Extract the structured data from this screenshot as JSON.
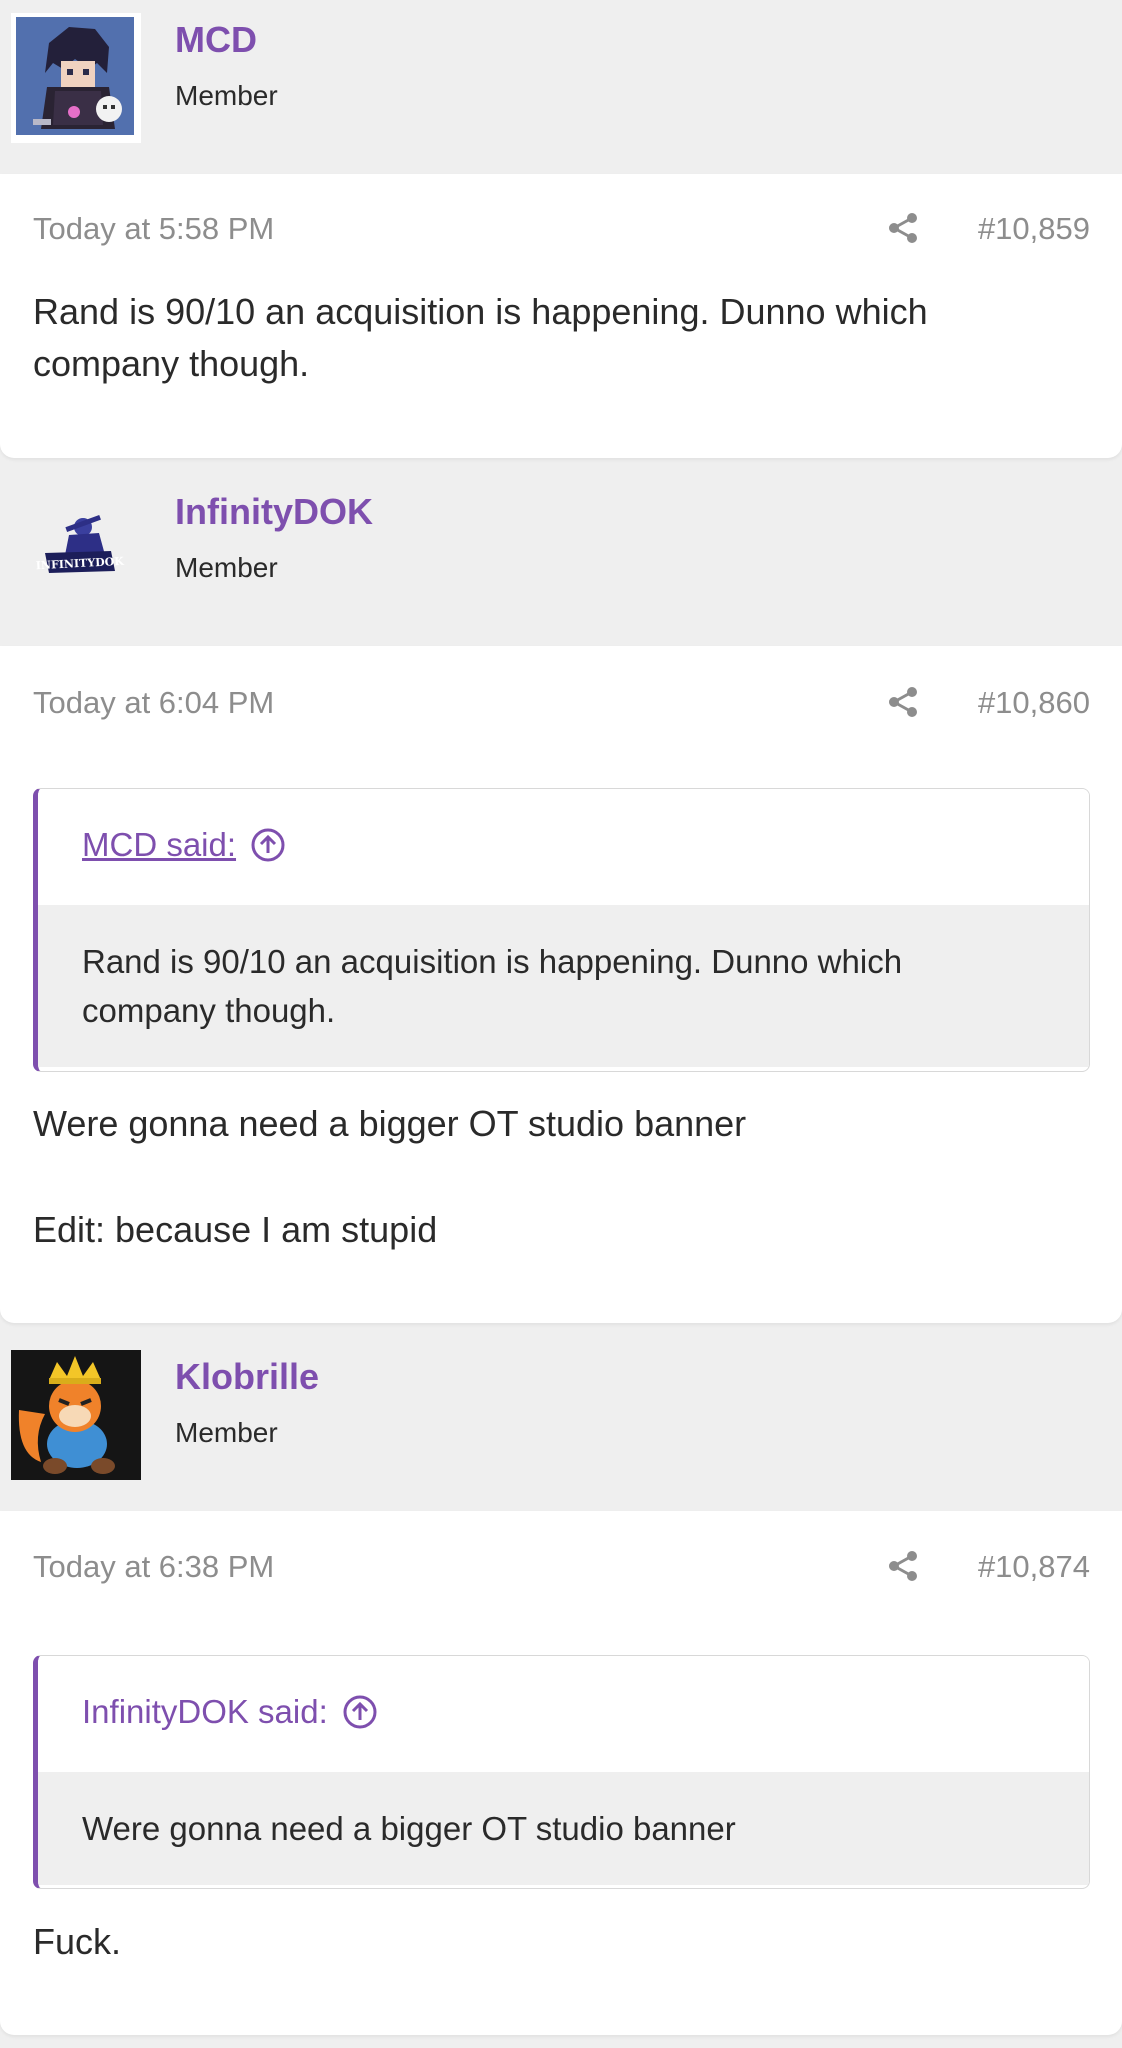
{
  "posts": [
    {
      "author": "MCD",
      "author_title": "Member",
      "date": "Today at 5:58 PM",
      "number": "#10,859",
      "body": "Rand is 90/10 an acquisition is happening. Dunno which company though."
    },
    {
      "author": "InfinityDOK",
      "author_title": "Member",
      "avatar_text": "INFINITYDOK",
      "date": "Today at 6:04 PM",
      "number": "#10,860",
      "quote": {
        "author": "MCD said:",
        "body": "Rand is 90/10 an acquisition is happening. Dunno which company though."
      },
      "body_lines": [
        "Were gonna need a bigger OT studio banner",
        "Edit: because I am stupid"
      ]
    },
    {
      "author": "Klobrille",
      "author_title": "Member",
      "date": "Today at 6:38 PM",
      "number": "#10,874",
      "quote": {
        "author": "InfinityDOK said:",
        "body": "Were gonna need a bigger OT studio banner"
      },
      "body": "Fuck."
    }
  ],
  "colors": {
    "accent": "#7e4fae",
    "background": "#efefef",
    "card": "#ffffff",
    "muted_text": "#8d8d8d",
    "text": "#2a2a2a"
  },
  "icons": {
    "share": "share-icon",
    "jump_to_quote": "arrow-up-circle-icon"
  }
}
